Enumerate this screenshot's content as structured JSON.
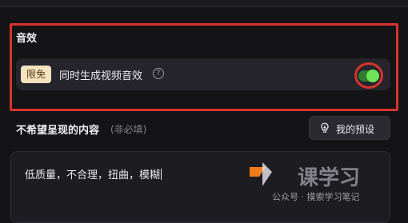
{
  "sound_section": {
    "title": "音效",
    "badge": "限免",
    "option_label": "同时生成视频音效",
    "help_icon": "?",
    "toggle_on": true
  },
  "exclude_section": {
    "title": "不希望呈现的内容",
    "optional_tag": "(非必填)",
    "preset_button_label": "我的预设",
    "preset_icon": "lightbulb-icon",
    "text_value": "低质量，不合理，扭曲，模糊"
  },
  "watermark": {
    "text": "公众号 · 摸索学习笔记"
  },
  "colors": {
    "background": "#141417",
    "highlight": "#d8332d",
    "toggle_on": "#6fe35a",
    "badge_bg": "#f4e3c0"
  }
}
